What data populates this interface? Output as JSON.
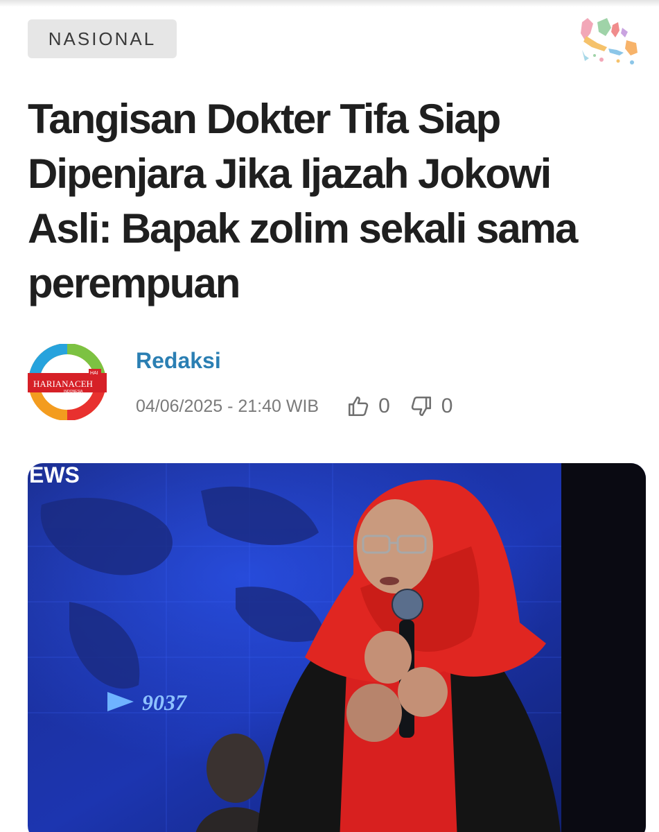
{
  "article": {
    "category": "NASIONAL",
    "title": "Tangisan Dokter Tifa Siap Dipenjara Jika Ijazah Jokowi Asli: Bapak zolim sekali sama perempuan",
    "author": "Redaksi",
    "published": "04/06/2025 - 21:40 WIB",
    "likes": "0",
    "dislikes": "0"
  },
  "publisher_logo": {
    "name": "HARIANACEH",
    "badge": "HAI",
    "tagline": "INDONESIA"
  },
  "hero_image": {
    "overlay_brand": "EWS",
    "overlay_counter": "9037"
  },
  "icons": {
    "map": "indonesia-map-icon",
    "like": "thumbs-up-icon",
    "dislike": "thumbs-down-icon"
  },
  "colors": {
    "author": "#2b7fb3",
    "title": "#1f1f1f",
    "badge_bg": "#e6e6e6"
  }
}
